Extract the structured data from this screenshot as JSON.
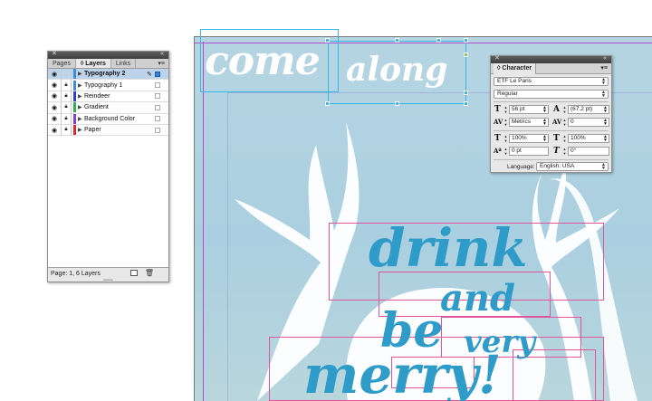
{
  "canvas": {
    "headline_top": [
      "come",
      "along"
    ],
    "headline_main": [
      "drink",
      "and",
      "be",
      "very",
      "merry!"
    ],
    "colors": {
      "background": "#b6d5e3",
      "white_text": "#ffffff",
      "blue_text": "#2e9bc9",
      "frame": "#e0559e",
      "selection": "#36b7e6"
    }
  },
  "layers_panel": {
    "tabs": [
      "Pages",
      "Layers",
      "Links"
    ],
    "active_tab": "Layers",
    "layers": [
      {
        "name": "Typography 2",
        "color": "#3f8be0",
        "selected": true
      },
      {
        "name": "Typography 1",
        "color": "#3f8be0",
        "selected": false
      },
      {
        "name": "Reindeer",
        "color": "#2a3fcf",
        "selected": false
      },
      {
        "name": "Gradient",
        "color": "#2bb24c",
        "selected": false
      },
      {
        "name": "Background Color",
        "color": "#8a3fcf",
        "selected": false
      },
      {
        "name": "Paper",
        "color": "#e0262e",
        "selected": false
      }
    ],
    "footer": "Page: 1, 6 Layers"
  },
  "character_panel": {
    "title": "Character",
    "font_family": "ETF Le Paris",
    "font_style": "Regular",
    "font_size": "56 pt",
    "leading": "(67.2 pt)",
    "kerning": "Metrics",
    "tracking": "0",
    "vertical_scale": "100%",
    "horizontal_scale": "100%",
    "baseline_shift": "0 pt",
    "skew": "0°",
    "language_label": "Language:",
    "language": "English: USA"
  }
}
